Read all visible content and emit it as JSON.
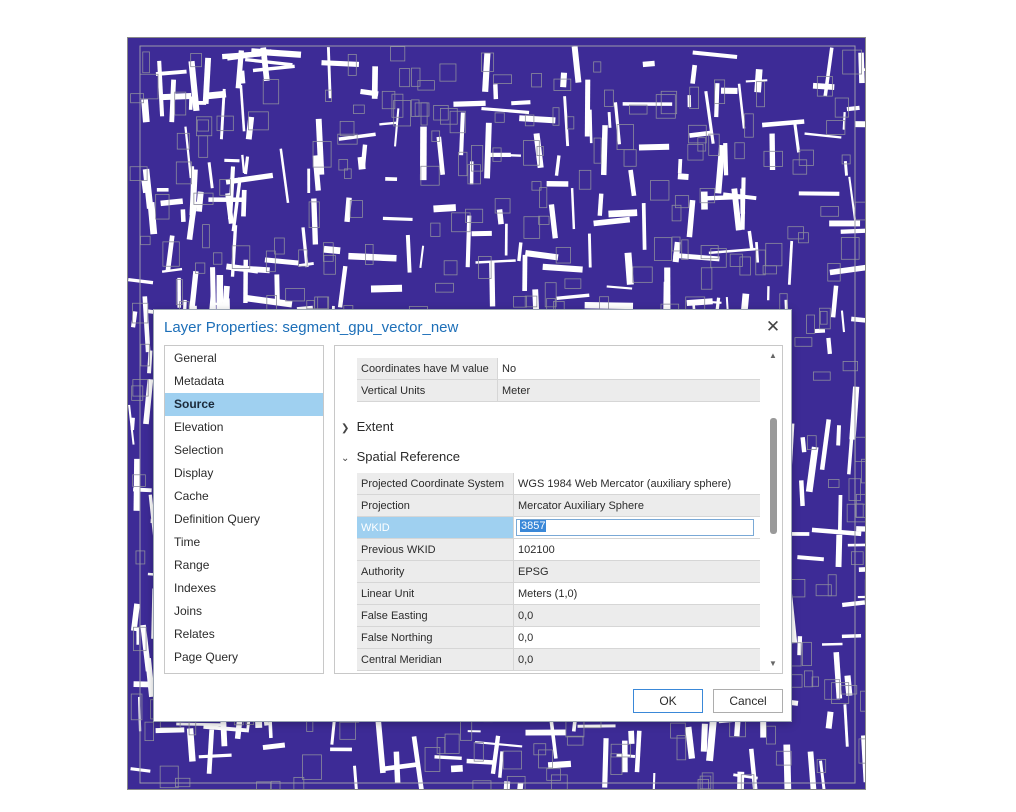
{
  "dialog": {
    "title": "Layer Properties: segment_gpu_vector_new",
    "close_glyph": "✕"
  },
  "nav": {
    "items": [
      "General",
      "Metadata",
      "Source",
      "Elevation",
      "Selection",
      "Display",
      "Cache",
      "Definition Query",
      "Time",
      "Range",
      "Indexes",
      "Joins",
      "Relates",
      "Page Query"
    ],
    "selected": "Source"
  },
  "top_table": [
    {
      "key": "Coordinates have M value",
      "value": "No"
    },
    {
      "key": "Vertical Units",
      "value": "Meter"
    }
  ],
  "sections": {
    "extent": "Extent",
    "spatial_reference": "Spatial Reference"
  },
  "spatial_table": [
    {
      "key": "Projected Coordinate System",
      "value": "WGS 1984 Web Mercator (auxiliary sphere)"
    },
    {
      "key": "Projection",
      "value": "Mercator Auxiliary Sphere"
    },
    {
      "key": "WKID",
      "value": "3857"
    },
    {
      "key": "Previous WKID",
      "value": "102100"
    },
    {
      "key": "Authority",
      "value": "EPSG"
    },
    {
      "key": "Linear Unit",
      "value": "Meters (1,0)"
    },
    {
      "key": "False Easting",
      "value": "0,0"
    },
    {
      "key": "False Northing",
      "value": "0,0"
    },
    {
      "key": "Central Meridian",
      "value": "0,0"
    }
  ],
  "buttons": {
    "ok": "OK",
    "cancel": "Cancel"
  },
  "colors": {
    "map_fill": "#3d2b96",
    "selection": "#9fd0f0",
    "title": "#1d6fb8"
  }
}
